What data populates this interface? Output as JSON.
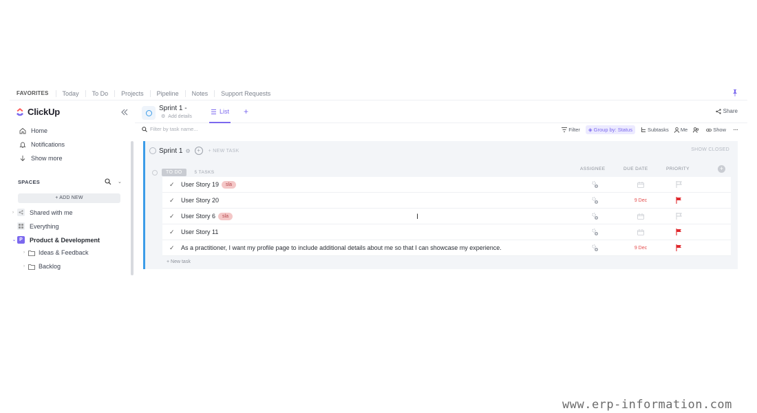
{
  "favorites": {
    "title": "FAVORITES",
    "items": [
      "Today",
      "To Do",
      "Projects",
      "Pipeline",
      "Notes",
      "Support Requests"
    ]
  },
  "sidebar": {
    "logo": "ClickUp",
    "nav": [
      {
        "label": "Home",
        "icon": "home-icon"
      },
      {
        "label": "Notifications",
        "icon": "bell-icon"
      },
      {
        "label": "Show more",
        "icon": "arrow-down-icon"
      }
    ],
    "spaces_title": "SPACES",
    "add_new": "+ ADD NEW",
    "spaces": [
      {
        "label": "Shared with me",
        "icon": "share-icon"
      },
      {
        "label": "Everything",
        "icon": "grid-icon"
      },
      {
        "label": "Product & Development",
        "icon": "space-avatar",
        "avatar": "P"
      },
      {
        "label": "Ideas & Feedback",
        "icon": "folder-icon"
      },
      {
        "label": "Backlog",
        "icon": "folder-icon"
      }
    ]
  },
  "header": {
    "title": "Sprint 1 -",
    "add_details": "Add details",
    "view_tab": "List",
    "add_view": "+",
    "share": "Share"
  },
  "toolbar": {
    "search_placeholder": "Filter by task name...",
    "filter": "Filter",
    "group_by": "Group by: Status",
    "subtasks": "Subtasks",
    "me": "Me",
    "show": "Show",
    "more": "···"
  },
  "list": {
    "sprint_name": "Sprint 1",
    "new_task_top": "+ NEW TASK",
    "show_closed": "SHOW CLOSED",
    "status": "TO DO",
    "task_count": "5 TASKS",
    "columns": {
      "assignee": "ASSIGNEE",
      "due_date": "DUE DATE",
      "priority": "PRIORITY"
    },
    "tasks": [
      {
        "name": "User Story 19",
        "tag": "sla",
        "due": "",
        "priority": "none"
      },
      {
        "name": "User Story 20",
        "tag": "",
        "due": "9 Dec",
        "priority": "urgent"
      },
      {
        "name": "User Story 6",
        "tag": "sla",
        "due": "",
        "priority": "none"
      },
      {
        "name": "User Story 11",
        "tag": "",
        "due": "",
        "priority": "urgent"
      },
      {
        "name": "As a practitioner, I want my profile page to include additional details about me so that I can showcase my experience.",
        "tag": "",
        "due": "9 Dec",
        "priority": "urgent"
      }
    ],
    "new_task": "+ New task"
  },
  "colors": {
    "accent": "#7b68ee",
    "sprint_blue": "#3b9ce8",
    "urgent_red": "#e0292e",
    "tag_bg": "#f4c7c7"
  },
  "watermark": "www.erp-information.com"
}
